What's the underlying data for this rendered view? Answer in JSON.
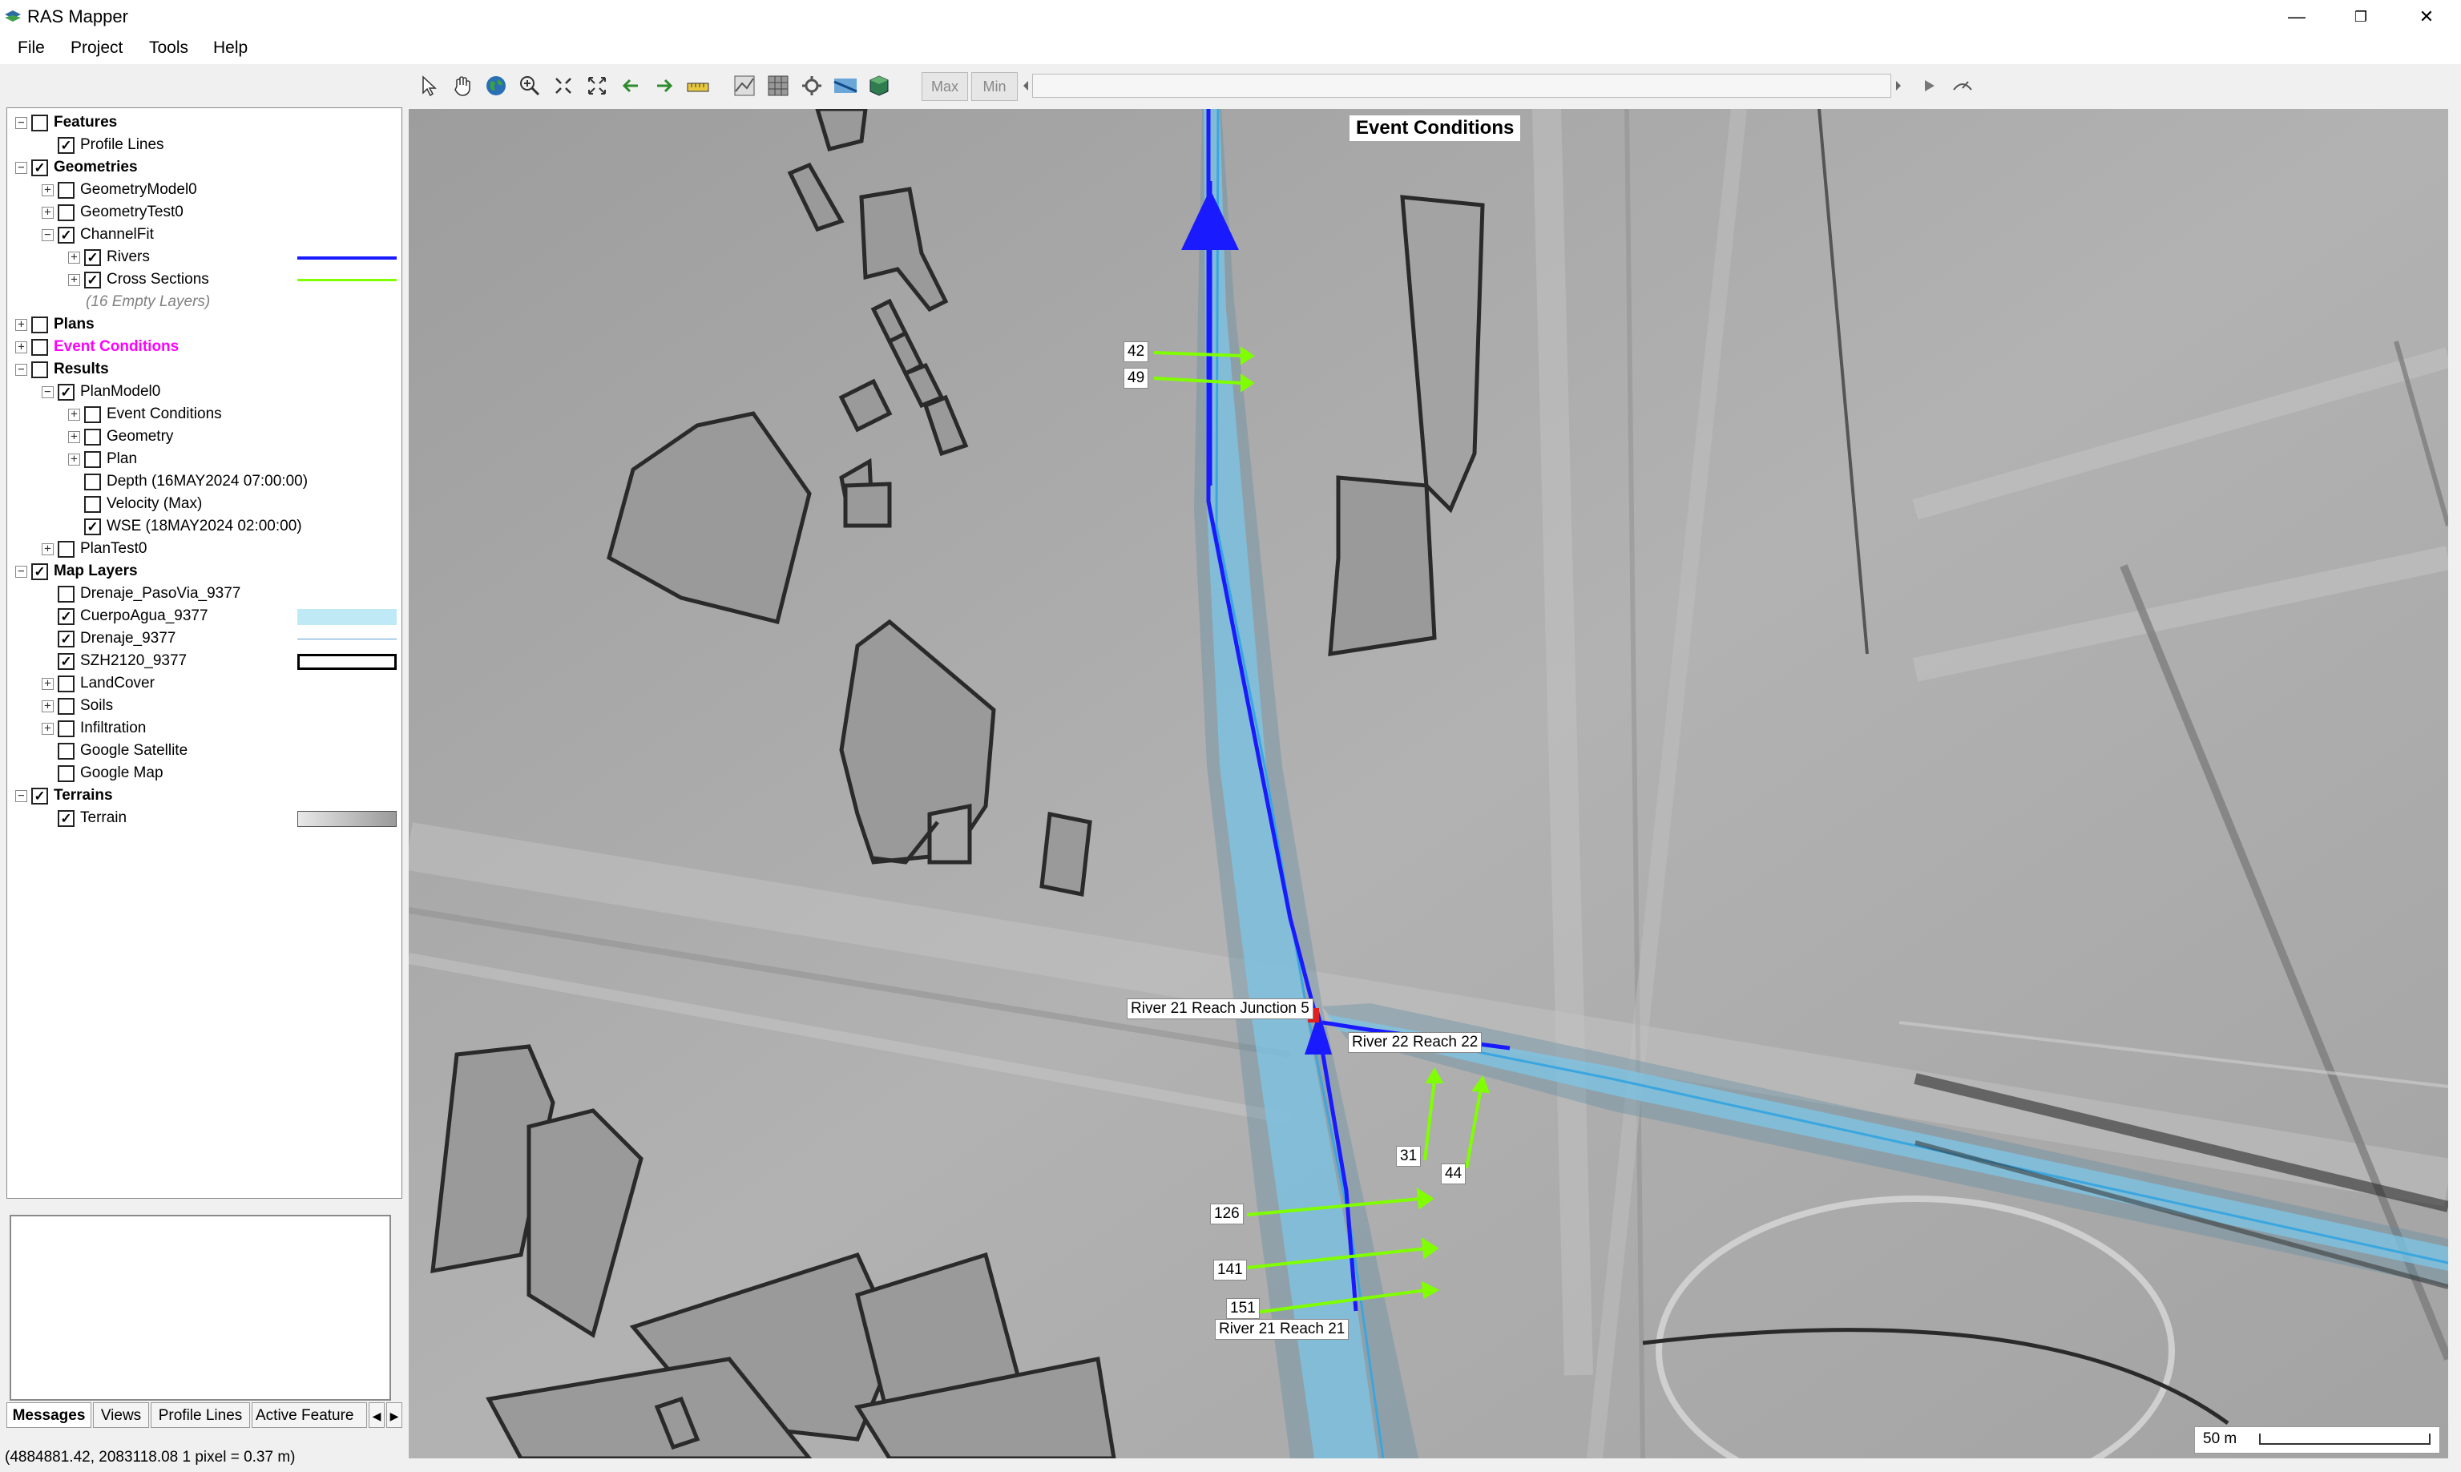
{
  "app": {
    "title": "RAS Mapper",
    "minimize": "—",
    "maximize": "❐",
    "close": "✕"
  },
  "menu": [
    "File",
    "Project",
    "Tools",
    "Help"
  ],
  "toolbar": {
    "max_label": "Max",
    "min_label": "Min"
  },
  "tree": [
    {
      "label": "Features",
      "level": 0,
      "exp": "−",
      "checked": false,
      "style": "bold"
    },
    {
      "label": "Profile Lines",
      "level": 1,
      "exp": "",
      "checked": true
    },
    {
      "label": "Geometries",
      "level": 0,
      "exp": "−",
      "checked": true,
      "style": "bold"
    },
    {
      "label": "GeometryModel0",
      "level": 1,
      "exp": "+",
      "checked": false
    },
    {
      "label": "GeometryTest0",
      "level": 1,
      "exp": "+",
      "checked": false
    },
    {
      "label": "ChannelFit",
      "level": 1,
      "exp": "−",
      "checked": true
    },
    {
      "label": "Rivers",
      "level": 2,
      "exp": "+",
      "checked": true,
      "legend": "river"
    },
    {
      "label": "Cross Sections",
      "level": 2,
      "exp": "+",
      "checked": true,
      "legend": "xs"
    },
    {
      "label": "(16 Empty Layers)",
      "level": 2,
      "exp": "",
      "checked": null,
      "style": "italic-gray"
    },
    {
      "label": "Plans",
      "level": 0,
      "exp": "+",
      "checked": false,
      "style": "bold"
    },
    {
      "label": "Event Conditions",
      "level": 0,
      "exp": "+",
      "checked": false,
      "style": "bold magenta"
    },
    {
      "label": "Results",
      "level": 0,
      "exp": "−",
      "checked": false,
      "style": "bold"
    },
    {
      "label": "PlanModel0",
      "level": 1,
      "exp": "−",
      "checked": true
    },
    {
      "label": "Event Conditions",
      "level": 2,
      "exp": "+",
      "checked": false
    },
    {
      "label": "Geometry",
      "level": 2,
      "exp": "+",
      "checked": false
    },
    {
      "label": "Plan",
      "level": 2,
      "exp": "+",
      "checked": false
    },
    {
      "label": "Depth (16MAY2024 07:00:00)",
      "level": 2,
      "exp": "",
      "checked": false
    },
    {
      "label": "Velocity (Max)",
      "level": 2,
      "exp": "",
      "checked": false
    },
    {
      "label": "WSE (18MAY2024 02:00:00)",
      "level": 2,
      "exp": "",
      "checked": true
    },
    {
      "label": "PlanTest0",
      "level": 1,
      "exp": "+",
      "checked": false
    },
    {
      "label": "Map Layers",
      "level": 0,
      "exp": "−",
      "checked": true,
      "style": "bold"
    },
    {
      "label": "Drenaje_PasoVia_9377",
      "level": 1,
      "exp": "",
      "checked": false
    },
    {
      "label": "CuerpoAgua_9377",
      "level": 1,
      "exp": "",
      "checked": true,
      "legend": "water"
    },
    {
      "label": "Drenaje_9377",
      "level": 1,
      "exp": "",
      "checked": true,
      "legend": "thinline"
    },
    {
      "label": "SZH2120_9377",
      "level": 1,
      "exp": "",
      "checked": true,
      "legend": "box"
    },
    {
      "label": "LandCover",
      "level": 1,
      "exp": "+",
      "checked": false
    },
    {
      "label": "Soils",
      "level": 1,
      "exp": "+",
      "checked": false
    },
    {
      "label": "Infiltration",
      "level": 1,
      "exp": "+",
      "checked": false
    },
    {
      "label": "Google Satellite",
      "level": 1,
      "exp": "",
      "checked": false
    },
    {
      "label": "Google Map",
      "level": 1,
      "exp": "",
      "checked": false
    },
    {
      "label": "Terrains",
      "level": 0,
      "exp": "−",
      "checked": true,
      "style": "bold"
    },
    {
      "label": "Terrain",
      "level": 1,
      "exp": "",
      "checked": true,
      "legend": "gradient"
    }
  ],
  "tabs": [
    "Messages",
    "Views",
    "Profile Lines",
    "Active Feature"
  ],
  "status": "(4884881.42, 2083118.08  1 pixel = 0.37 m)",
  "map": {
    "title": "Event Conditions",
    "scale_label": "50 m",
    "xs_labels": [
      "42",
      "49",
      "31",
      "44",
      "126",
      "141",
      "151"
    ],
    "reach_labels": [
      "River 21  Reach Junction 5",
      "River 22  Reach 22",
      "River 21  Reach 21"
    ]
  },
  "colors": {
    "river": "#1a1aff",
    "xs": "#7fff00",
    "water": "#bfeaf5",
    "magenta": "#ff00ff"
  }
}
